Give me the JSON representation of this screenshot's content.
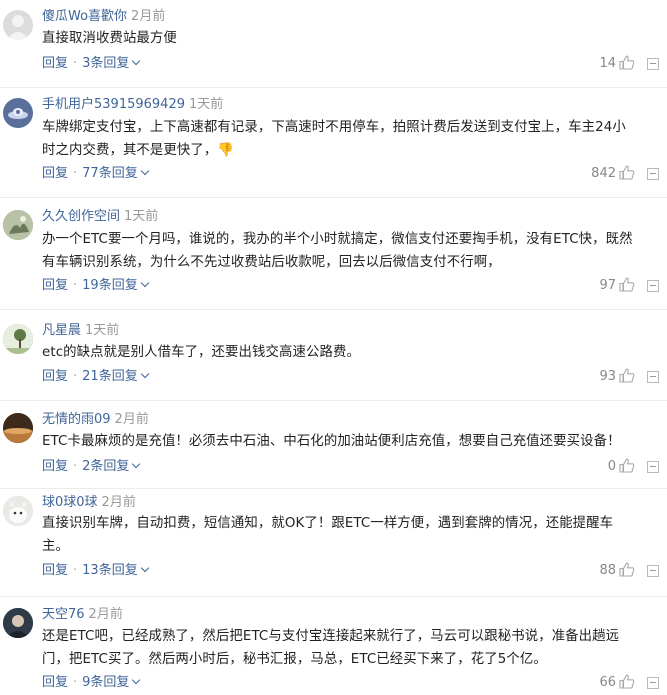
{
  "colors": {
    "username": "#406599",
    "time": "#999999",
    "text": "#222222",
    "link": "#406599",
    "count": "#888888",
    "divider": "#ececec"
  },
  "comments": [
    {
      "username": "傻瓜Wo喜歡你",
      "time": "2月前",
      "lines": [
        "直接取消收费站最方便"
      ],
      "reply_label": "回复",
      "replies_label": "3条回复",
      "likes": "14",
      "avatar_color": "#dedede"
    },
    {
      "username": "手机用户53915969429",
      "time": "1天前",
      "lines": [
        "车牌绑定支付宝，上下高速都有记录，下高速时不用停车，拍照计费后发送到支付宝上，车主24小",
        "时之内交费，其不是更快了，👎"
      ],
      "reply_label": "回复",
      "replies_label": "77条回复",
      "likes": "842",
      "avatar_color": "#5a6f9a"
    },
    {
      "username": "久久创作空间",
      "time": "1天前",
      "lines": [
        "办一个ETC要一个月吗，谁说的，我办的半个小时就搞定，微信支付还要掏手机，没有ETC快，既然",
        "有车辆识别系统，为什么不先过收费站后收款呢，回去以后微信支付不行啊，"
      ],
      "reply_label": "回复",
      "replies_label": "19条回复",
      "likes": "97",
      "avatar_color": "#8a9a7a"
    },
    {
      "username": "凡星晨",
      "time": "1天前",
      "lines": [
        "etc的缺点就是别人借车了，还要出钱交高速公路费。"
      ],
      "reply_label": "回复",
      "replies_label": "21条回复",
      "likes": "93",
      "avatar_color": "#7a8f6a"
    },
    {
      "username": "无情的雨09",
      "time": "2月前",
      "lines": [
        "ETC卡最麻烦的是充值！必须去中石油、中石化的加油站便利店充值，想要自己充值还要买设备！"
      ],
      "reply_label": "回复",
      "replies_label": "2条回复",
      "likes": "0",
      "avatar_color": "#9a6a3a"
    },
    {
      "username": "球0球0球",
      "time": "2月前",
      "lines": [
        "直接识别车牌，自动扣费，短信通知，就OK了！跟ETC一样方便，遇到套牌的情况，还能提醒车",
        "主。"
      ],
      "reply_label": "回复",
      "replies_label": "13条回复",
      "likes": "88",
      "avatar_color": "#c9c9c9"
    },
    {
      "username": "天空76",
      "time": "2月前",
      "lines": [
        "还是ETC吧，已经成熟了，然后把ETC与支付宝连接起来就行了，马云可以跟秘书说，准备出趟远",
        "门，把ETC买了。然后两小时后，秘书汇报，马总，ETC已经买下来了，花了5个亿。"
      ],
      "reply_label": "回复",
      "replies_label": "9条回复",
      "likes": "66",
      "avatar_color": "#3a4a5a"
    }
  ]
}
